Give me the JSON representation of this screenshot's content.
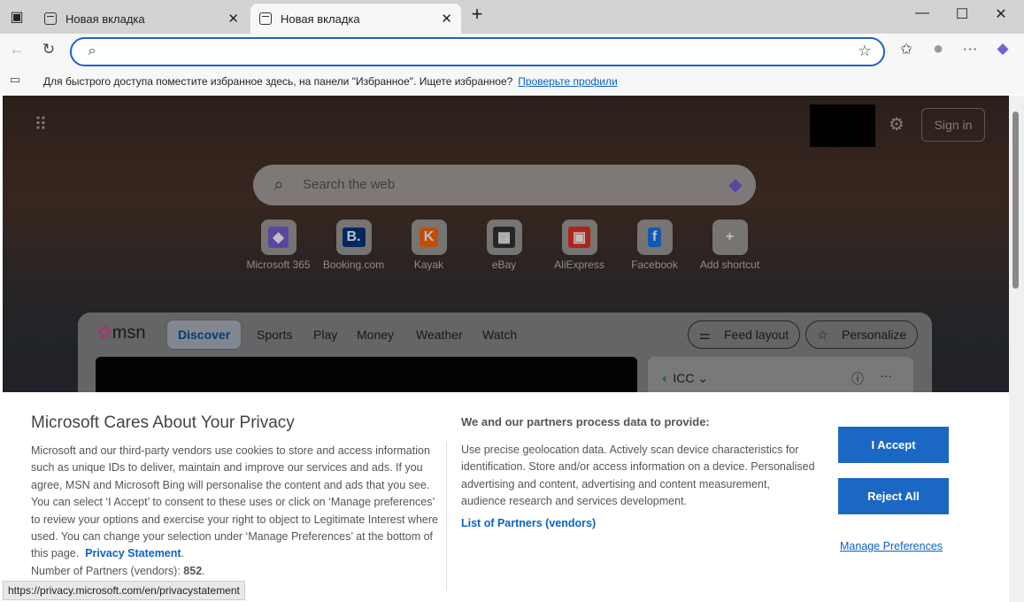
{
  "tabs": [
    {
      "label": "Новая вкладка"
    },
    {
      "label": "Новая вкладка",
      "active": true
    }
  ],
  "favbar": {
    "text": "Для быстрого доступа поместите избранное здесь, на панели \"Избранное\". Ищете избранное?",
    "link": "Проверьте профили"
  },
  "page": {
    "search_placeholder": "Search the web",
    "sign_in": "Sign in",
    "shortcuts": [
      {
        "label": "Microsoft 365",
        "glyph": "◆",
        "color": "#7a5cd6"
      },
      {
        "label": "Booking.com",
        "glyph": "B.",
        "color": "#003580"
      },
      {
        "label": "Kayak",
        "glyph": "K",
        "color": "#ff690f"
      },
      {
        "label": "eBay",
        "glyph": "▦",
        "color": "#333"
      },
      {
        "label": "AliExpress",
        "glyph": "▣",
        "color": "#e43225"
      },
      {
        "label": "Facebook",
        "glyph": "f",
        "color": "#1877f2"
      },
      {
        "label": "Add shortcut",
        "glyph": "+",
        "color": "transparent"
      }
    ],
    "msn": {
      "logo": "msn",
      "nav": [
        "Discover",
        "Sports",
        "Play",
        "Money",
        "Weather",
        "Watch"
      ],
      "feed_layout": "Feed layout",
      "personalize": "Personalize",
      "card_title": "ICC"
    }
  },
  "privacy": {
    "title": "Microsoft Cares About Your Privacy",
    "body": "Microsoft and our third-party vendors use cookies to store and access information such as unique IDs to deliver, maintain and improve our services and ads. If you agree, MSN and Microsoft Bing will personalise the content and ads that you see. You can select ‘I Accept’ to consent to these uses or click on ‘Manage preferences’ to review your options and exercise your right to object to Legitimate Interest where used.  You can change your selection under ‘Manage Preferences’ at the bottom of this page.",
    "privacy_link": "Privacy Statement",
    "partners_label": "Number of Partners (vendors):",
    "partners_count": "852",
    "data_title": "We and our partners process data to provide:",
    "data_body": "Use precise geolocation data. Actively scan device characteristics for identification. Store and/or access information on a device. Personalised advertising and content, advertising and content measurement, audience research and services development.",
    "partners_link": "List of Partners (vendors)",
    "accept": "I Accept",
    "reject": "Reject All",
    "manage": "Manage Preferences"
  },
  "status_url": "https://privacy.microsoft.com/en/privacystatement"
}
